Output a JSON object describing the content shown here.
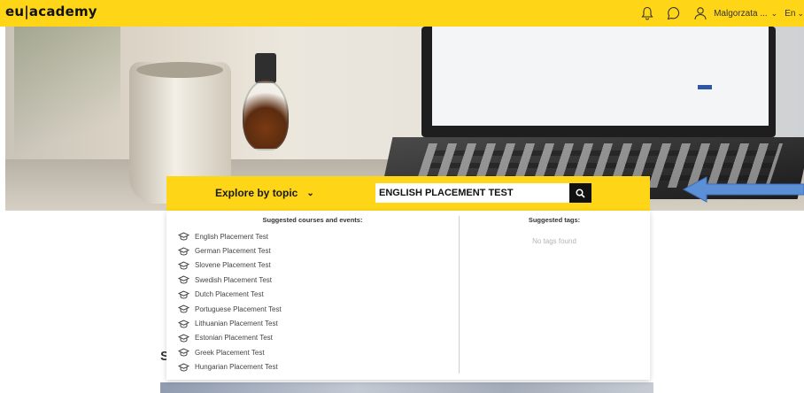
{
  "header": {
    "logo": "eu|academy",
    "user_name": "Malgorzata ...",
    "language": "En",
    "icons": [
      "bell-icon",
      "chat-icon",
      "user-icon"
    ]
  },
  "search": {
    "explore_label": "Explore by topic",
    "query": "ENGLISH PLACEMENT TEST"
  },
  "dropdown": {
    "courses_heading": "Suggested courses and events:",
    "tags_heading": "Suggested tags:",
    "no_tags": "No tags found",
    "courses": [
      "English Placement Test",
      "German Placement Test",
      "Slovene Placement Test",
      "Swedish Placement Test",
      "Dutch Placement Test",
      "Portuguese Placement Test",
      "Lithuanian Placement Test",
      "Estonian Placement Test",
      "Greek Placement Test",
      "Hungarian Placement Test"
    ]
  },
  "page": {
    "section_initial": "S"
  },
  "colors": {
    "brand_yellow": "#ffd617",
    "annotation_arrow": "#5b8fd6"
  }
}
